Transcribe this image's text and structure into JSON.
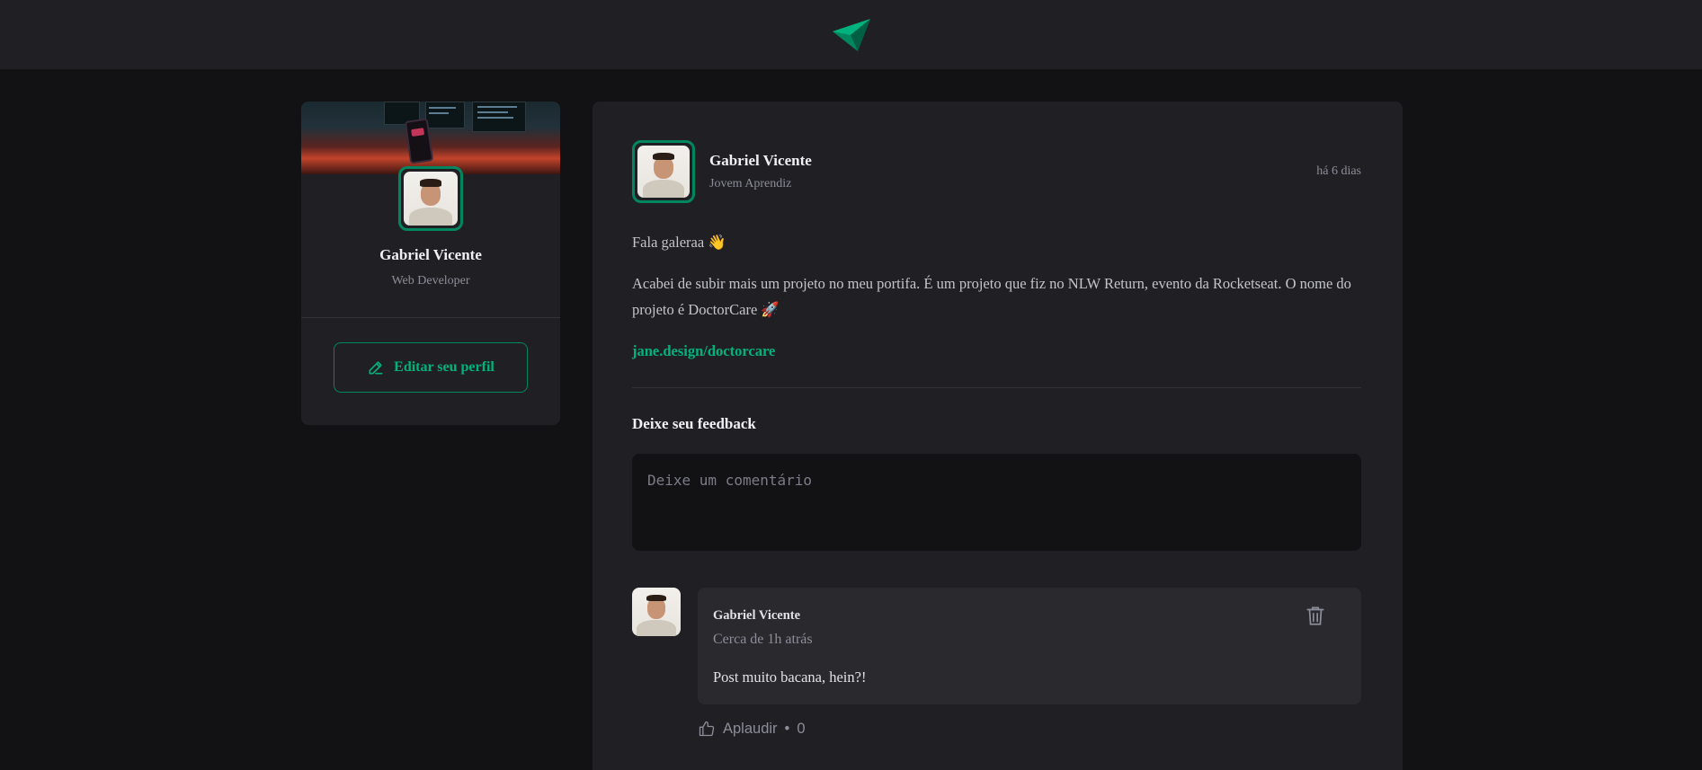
{
  "header": {
    "logo_icon": "paper-plane-icon",
    "brand_color": "#00b37e"
  },
  "sidebar": {
    "name": "Gabriel Vicente",
    "role": "Web Developer",
    "edit_button_label": "Editar seu perfil",
    "edit_icon": "pencil-line-icon"
  },
  "post": {
    "author": {
      "name": "Gabriel Vicente",
      "role": "Jovem Aprendiz"
    },
    "time": "há 6 dias",
    "paragraphs": [
      "Fala galeraa 👋",
      "Acabei de subir mais um projeto no meu portifa. É um projeto que fiz no NLW Return, evento da Rocketseat. O nome do projeto é DoctorCare 🚀"
    ],
    "link": "jane.design/doctorcare",
    "feedback": {
      "title": "Deixe seu feedback",
      "placeholder": "Deixe um comentário"
    },
    "comments": [
      {
        "author": "Gabriel Vicente",
        "time": "Cerca de 1h atrás",
        "content": "Post muito bacana, hein?!",
        "applaud_label": "Aplaudir",
        "applaud_separator": "•",
        "applaud_count": "0"
      }
    ]
  },
  "colors": {
    "background": "#121214",
    "surface": "#202024",
    "accent": "#00875f",
    "accent_light": "#00b37e"
  }
}
